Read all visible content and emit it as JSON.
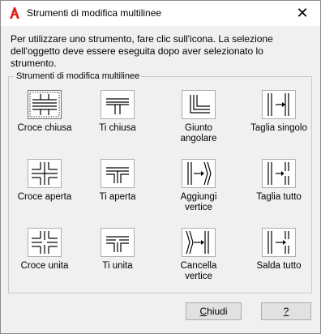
{
  "window": {
    "title": "Strumenti di modifica multilinee",
    "close_glyph": "✕"
  },
  "instructions": "Per utilizzare uno strumento, fare clic sull'icona. La selezione dell'oggetto deve essere eseguita dopo aver selezionato lo strumento.",
  "group": {
    "legend": "Strumenti di modifica multilinee"
  },
  "tools": [
    {
      "icon": "closed-cross-icon",
      "label": "Croce chiusa"
    },
    {
      "icon": "closed-tee-icon",
      "label": "Ti chiusa"
    },
    {
      "icon": "corner-joint-icon",
      "label": "Giunto angolare"
    },
    {
      "icon": "cut-single-icon",
      "label": "Taglia singolo"
    },
    {
      "icon": "open-cross-icon",
      "label": "Croce aperta"
    },
    {
      "icon": "open-tee-icon",
      "label": "Ti aperta"
    },
    {
      "icon": "add-vertex-icon",
      "label": "Aggiungi vertice"
    },
    {
      "icon": "cut-all-icon",
      "label": "Taglia tutto"
    },
    {
      "icon": "merged-cross-icon",
      "label": "Croce unita"
    },
    {
      "icon": "merged-tee-icon",
      "label": "Ti unita"
    },
    {
      "icon": "delete-vertex-icon",
      "label": "Cancella vertice"
    },
    {
      "icon": "weld-all-icon",
      "label": "Salda tutto"
    }
  ],
  "buttons": {
    "close_mnemonic": "C",
    "close_rest": "hiudi",
    "help": "?"
  }
}
